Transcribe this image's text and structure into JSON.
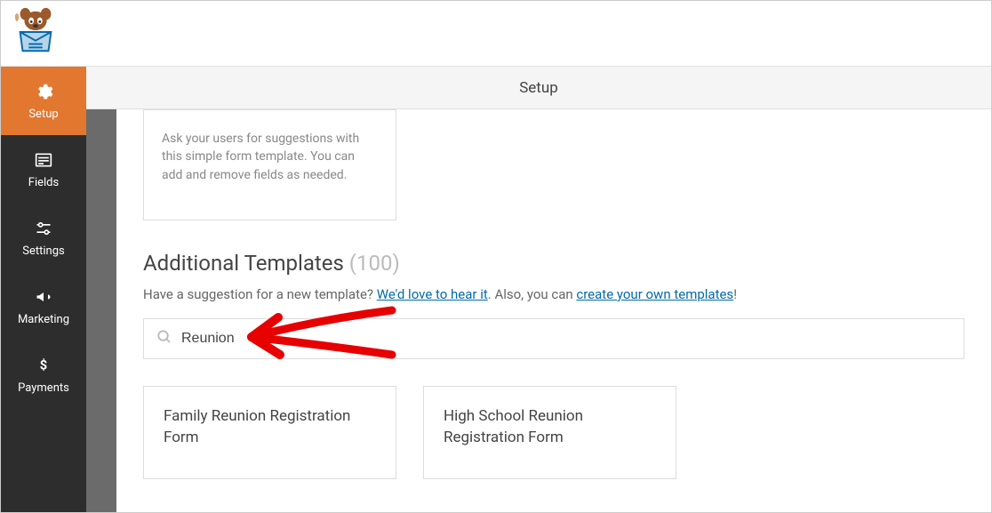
{
  "header": {
    "title": "Setup"
  },
  "sidebar": {
    "items": [
      {
        "label": "Setup"
      },
      {
        "label": "Fields"
      },
      {
        "label": "Settings"
      },
      {
        "label": "Marketing"
      },
      {
        "label": "Payments"
      }
    ]
  },
  "intro_card": {
    "description": "Ask your users for suggestions with this simple form template. You can add and remove fields as needed."
  },
  "section": {
    "title": "Additional Templates",
    "count": "(100)"
  },
  "suggestion": {
    "pre_text": "Have a suggestion for a new template? ",
    "link1": "We'd love to hear it",
    "mid_text": ". Also, you can ",
    "link2": "create your own templates",
    "post_text": "!"
  },
  "search": {
    "value": "Reunion",
    "placeholder": ""
  },
  "results": [
    {
      "title": "Family Reunion Registration Form"
    },
    {
      "title": "High School Reunion Registration Form"
    }
  ]
}
